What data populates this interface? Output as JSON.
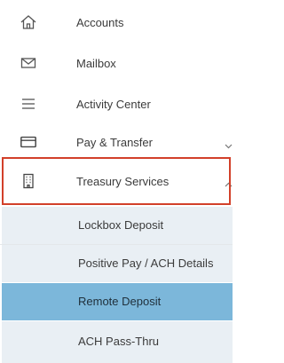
{
  "nav": {
    "items": [
      {
        "label": "Accounts",
        "icon": "home-icon"
      },
      {
        "label": "Mailbox",
        "icon": "mail-icon"
      },
      {
        "label": "Activity Center",
        "icon": "menu-lines-icon"
      },
      {
        "label": "Pay & Transfer",
        "icon": "card-icon",
        "expandable": true
      },
      {
        "label": "Treasury Services",
        "icon": "building-icon",
        "expanded": true
      }
    ],
    "sub_items": [
      {
        "label": "Lockbox Deposit"
      },
      {
        "label": "Positive Pay / ACH Details"
      },
      {
        "label": "Remote Deposit",
        "active": true
      },
      {
        "label": "ACH Pass-Thru"
      }
    ]
  },
  "colors": {
    "highlight_border": "#d2402a",
    "submenu_bg": "#e9eff4",
    "active_bg": "#7cb7da"
  }
}
